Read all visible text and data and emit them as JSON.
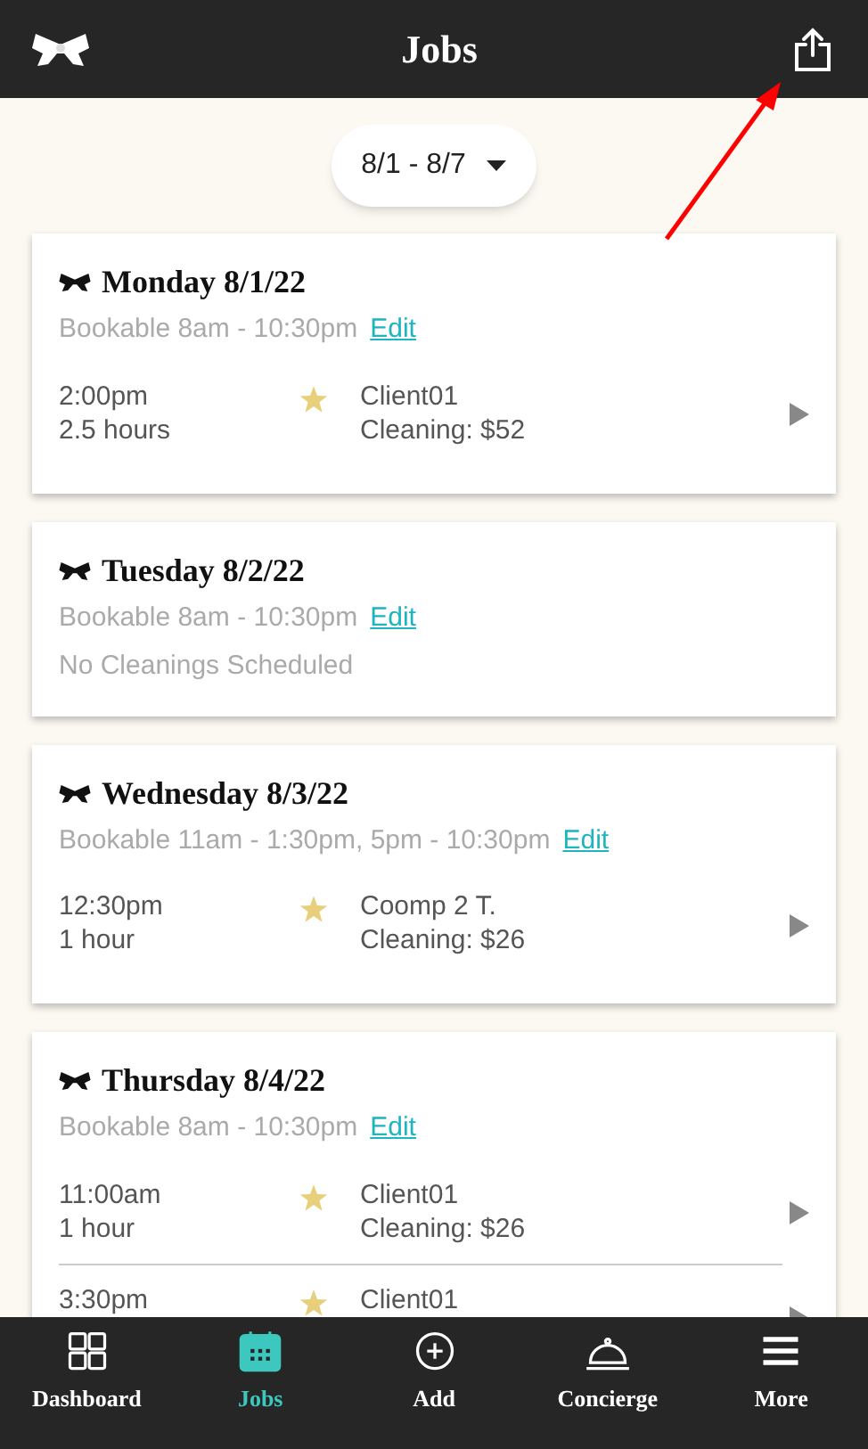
{
  "header": {
    "title": "Jobs"
  },
  "date_range": {
    "value": "8/1 - 8/7"
  },
  "days": [
    {
      "title": "Monday 8/1/22",
      "bookable": "Bookable 8am - 10:30pm",
      "edit": "Edit",
      "jobs": [
        {
          "time": "2:00pm",
          "duration": "2.5 hours",
          "client": "Client01",
          "service": "Cleaning: $52"
        }
      ]
    },
    {
      "title": "Tuesday 8/2/22",
      "bookable": "Bookable 8am - 10:30pm",
      "edit": "Edit",
      "empty": "No Cleanings Scheduled"
    },
    {
      "title": "Wednesday 8/3/22",
      "bookable": "Bookable 11am - 1:30pm, 5pm - 10:30pm",
      "edit": "Edit",
      "jobs": [
        {
          "time": "12:30pm",
          "duration": "1 hour",
          "client": "Coomp 2 T.",
          "service": "Cleaning: $26"
        }
      ]
    },
    {
      "title": "Thursday 8/4/22",
      "bookable": "Bookable 8am - 10:30pm",
      "edit": "Edit",
      "jobs": [
        {
          "time": "11:00am",
          "duration": "1 hour",
          "client": "Client01",
          "service": "Cleaning: $26"
        },
        {
          "time": "3:30pm",
          "client": "Client01"
        }
      ]
    }
  ],
  "nav": [
    {
      "kind": "grid",
      "label": "Dashboard",
      "selected": false
    },
    {
      "kind": "calendar",
      "label": "Jobs",
      "selected": true
    },
    {
      "kind": "plus",
      "label": "Add",
      "selected": false
    },
    {
      "kind": "bell",
      "label": "Concierge",
      "selected": false
    },
    {
      "kind": "menu",
      "label": "More",
      "selected": false
    }
  ]
}
